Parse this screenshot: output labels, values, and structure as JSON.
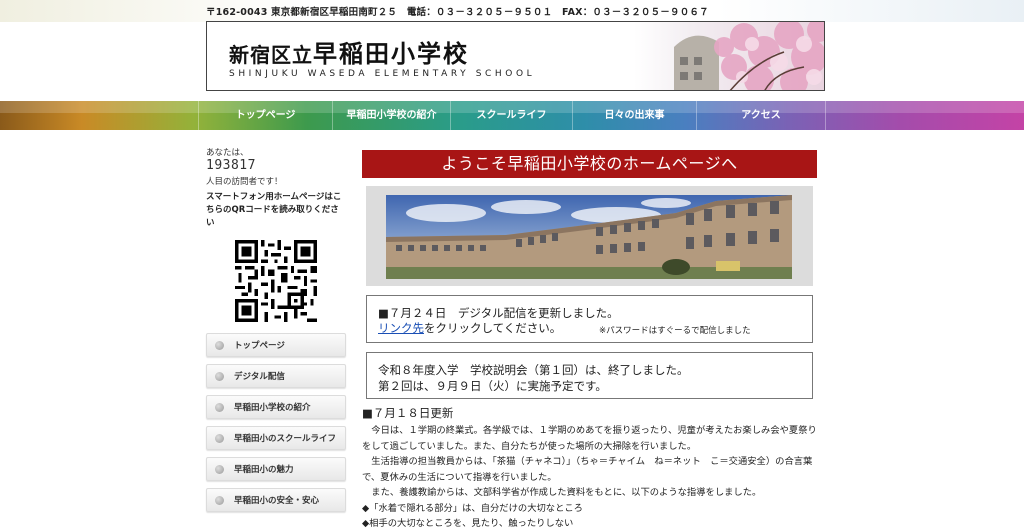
{
  "header": {
    "address": "〒162-0043 東京都新宿区早稲田南町２５　電話：０３－３２０５－９５０１　FAX：０３－３２０５－９０６７",
    "title_prefix": "新宿区立",
    "title_main": "早稲田小学校",
    "title_en": "SHINJUKU WASEDA ELEMENTARY SCHOOL"
  },
  "nav": {
    "items": [
      {
        "label": "トップページ"
      },
      {
        "label": "早稲田小学校の紹介"
      },
      {
        "label": "スクールライフ"
      },
      {
        "label": "日々の出来事"
      },
      {
        "label": "アクセス"
      }
    ]
  },
  "sidebar": {
    "visitor_label": "あなたは、",
    "counter": "193817",
    "visitor_suffix": "人目の訪問者です！",
    "qr_note": "スマートフォン用ホームページはこちらのQRコードを読み取りください",
    "links": [
      {
        "label": "トップページ"
      },
      {
        "label": "デジタル配信"
      },
      {
        "label": "早稲田小学校の紹介"
      },
      {
        "label": "早稲田小のスクールライフ"
      },
      {
        "label": "早稲田小の魅力"
      },
      {
        "label": "早稲田小の安全・安心"
      }
    ]
  },
  "main": {
    "welcome": "ようこそ早稲田小学校のホームページへ",
    "notice1": {
      "line1": "■７月２４日　デジタル配信を更新しました。",
      "link": "リンク先",
      "line2_rest": "をクリックしてください。",
      "note": "※パスワードはすぐーるで配信しました"
    },
    "notice2": {
      "line1": "令和８年度入学　学校説明会（第１回）は、終了しました。",
      "line2": "第２回は、９月９日（火）に実施予定です。"
    },
    "update_head": "■７月１８日更新",
    "paragraphs": [
      "　今日は、１学期の終業式。各学級では、１学期のめあてを振り返ったり、児童が考えたお楽しみ会や夏祭りをして過ごしていました。また、自分たちが使った場所の大掃除を行いました。",
      "　生活指導の担当教員からは、「茶猫（チャネコ）」（ちゃ＝チャイム　ね＝ネット　こ＝交通安全）の合言葉で、夏休みの生活について指導を行いました。",
      "　また、養護教諭からは、文部科学省が作成した資料をもとに、以下のような指導をしました。",
      "◆「水着で隠れる部分」は、自分だけの大切なところ",
      "◆相手の大切なところを、見たり、触ったりしない"
    ]
  },
  "colors": {
    "welcome_bg": "#a81515",
    "link": "#1a4fb5"
  }
}
